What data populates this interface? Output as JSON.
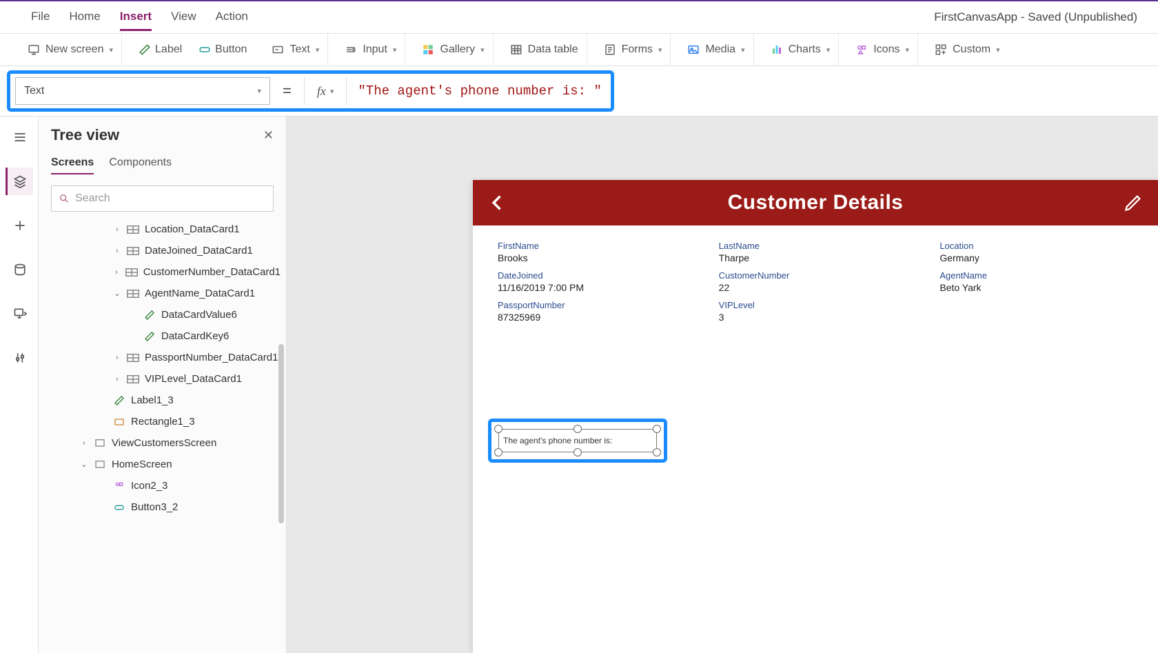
{
  "topTabs": {
    "file": "File",
    "home": "Home",
    "insert": "Insert",
    "view": "View",
    "action": "Action"
  },
  "statusText": "FirstCanvasApp - Saved (Unpublished)",
  "ribbon": {
    "newScreen": "New screen",
    "label": "Label",
    "button": "Button",
    "text": "Text",
    "input": "Input",
    "gallery": "Gallery",
    "dataTable": "Data table",
    "forms": "Forms",
    "media": "Media",
    "charts": "Charts",
    "icons": "Icons",
    "custom": "Custom"
  },
  "formula": {
    "property": "Text",
    "equals": "=",
    "fx": "fx",
    "expression": "\"The agent's phone number is: \""
  },
  "tree": {
    "title": "Tree view",
    "tabs": {
      "screens": "Screens",
      "components": "Components"
    },
    "searchPlaceholder": "Search",
    "items": {
      "loc": "Location_DataCard1",
      "date": "DateJoined_DataCard1",
      "custnum": "CustomerNumber_DataCard1",
      "agent": "AgentName_DataCard1",
      "dcv6": "DataCardValue6",
      "dck6": "DataCardKey6",
      "passport": "PassportNumber_DataCard1",
      "vip": "VIPLevel_DataCard1",
      "label13": "Label1_3",
      "rect13": "Rectangle1_3",
      "viewcust": "ViewCustomersScreen",
      "homescr": "HomeScreen",
      "icon23": "Icon2_3",
      "button32": "Button3_2"
    }
  },
  "canvas": {
    "headerTitle": "Customer Details",
    "fields": [
      {
        "label": "FirstName",
        "value": "Brooks"
      },
      {
        "label": "LastName",
        "value": "Tharpe"
      },
      {
        "label": "Location",
        "value": "Germany"
      },
      {
        "label": "DateJoined",
        "value": "11/16/2019 7:00 PM"
      },
      {
        "label": "CustomerNumber",
        "value": "22"
      },
      {
        "label": "AgentName",
        "value": "Beto Yark"
      },
      {
        "label": "PassportNumber",
        "value": "87325969"
      },
      {
        "label": "VIPLevel",
        "value": "3"
      }
    ],
    "selectedLabelText": "The agent's phone number is:"
  }
}
